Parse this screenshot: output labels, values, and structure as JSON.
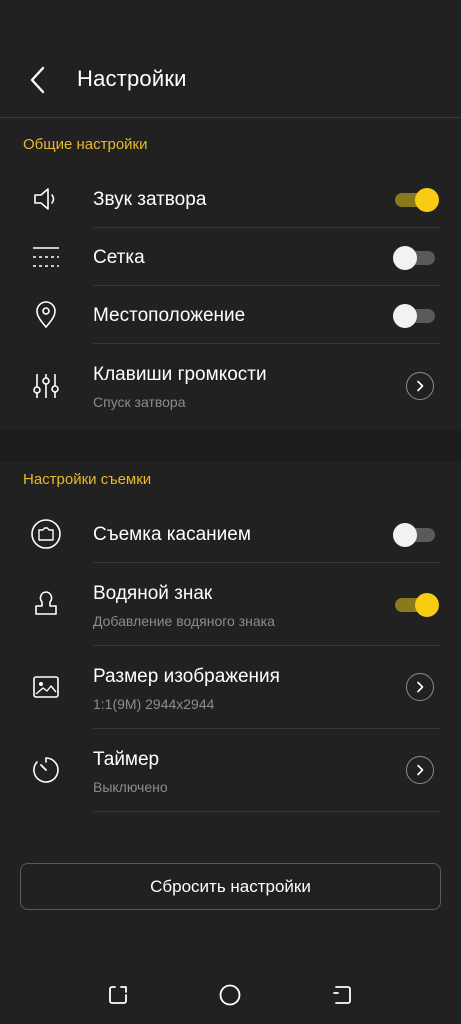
{
  "header": {
    "title": "Настройки",
    "back_icon": "chevron-left-icon"
  },
  "sections": [
    {
      "title": "Общие настройки",
      "items": [
        {
          "label": "Звук затвора",
          "icon": "speaker-icon",
          "control": "toggle",
          "on": true
        },
        {
          "label": "Сетка",
          "icon": "grid-lines-icon",
          "control": "toggle",
          "on": false
        },
        {
          "label": "Местоположение",
          "icon": "location-pin-icon",
          "control": "toggle",
          "on": false
        },
        {
          "label": "Клавиши громкости",
          "sublabel": "Спуск затвора",
          "icon": "sliders-icon",
          "control": "chevron"
        }
      ]
    },
    {
      "title": "Настройки съемки",
      "items": [
        {
          "label": "Съемка касанием",
          "icon": "touch-camera-icon",
          "control": "toggle",
          "on": false
        },
        {
          "label": "Водяной знак",
          "sublabel": "Добавление водяного знака",
          "icon": "watermark-stamp-icon",
          "control": "toggle",
          "on": true
        },
        {
          "label": "Размер изображения",
          "sublabel": "1:1(9M) 2944x2944",
          "icon": "image-size-icon",
          "control": "chevron"
        },
        {
          "label": "Таймер",
          "sublabel": "Выключено",
          "icon": "timer-icon",
          "control": "chevron"
        }
      ]
    }
  ],
  "reset_button": {
    "label": "Сбросить настройки"
  },
  "colors": {
    "background": "#212121",
    "accent": "#f7cc12",
    "section_title": "#e8b92a",
    "sublabel": "#8c8c8c"
  },
  "navbar": {
    "icons": [
      "recent-apps-icon",
      "home-icon",
      "back-nav-icon"
    ]
  }
}
